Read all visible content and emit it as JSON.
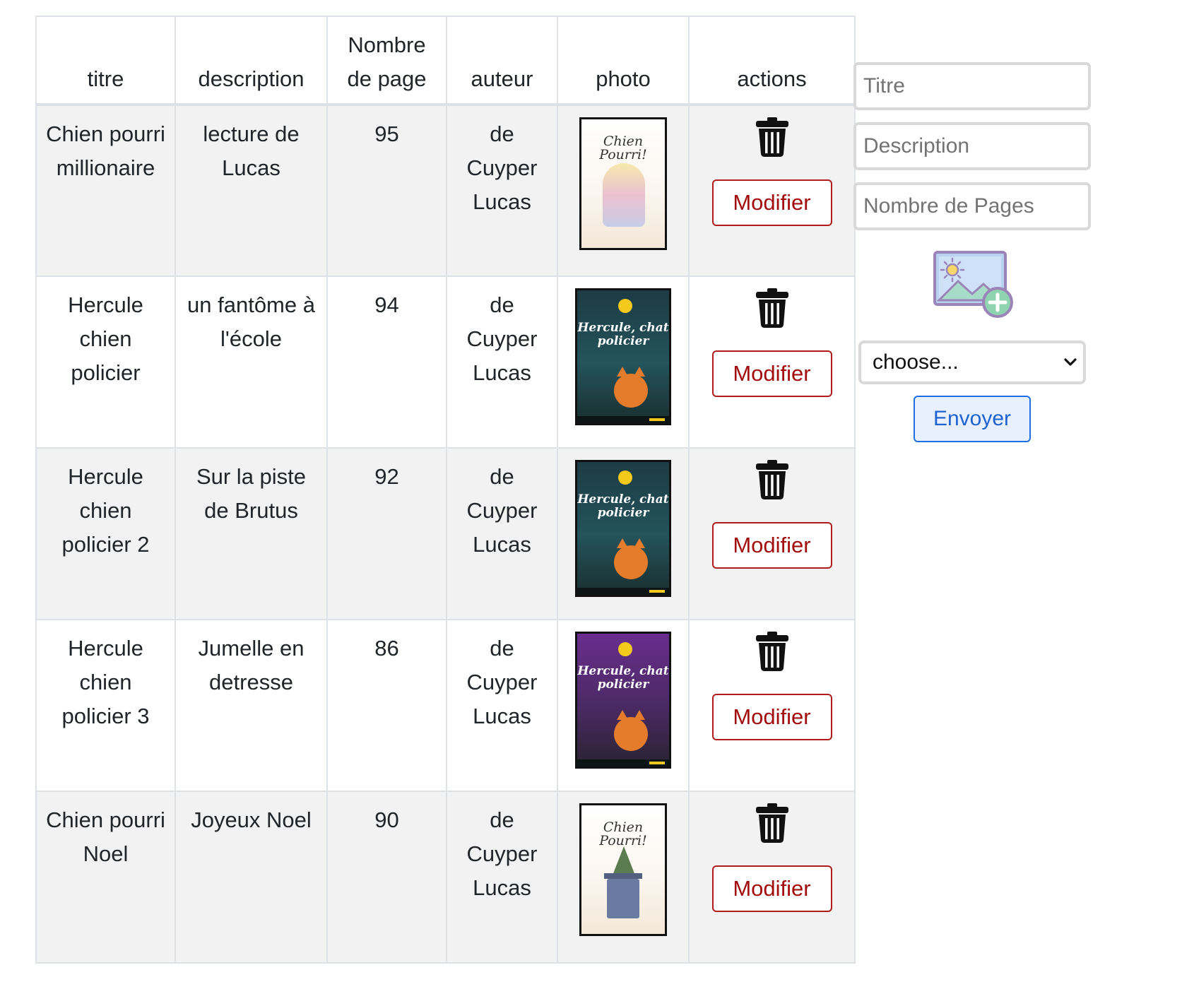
{
  "table": {
    "headers": {
      "titre": "titre",
      "description": "description",
      "pages_line1": "Nombre",
      "pages_line2": "de page",
      "auteur": "auteur",
      "photo": "photo",
      "actions": "actions"
    },
    "rows": [
      {
        "titre": "Chien pourri millionaire",
        "description": "lecture de Lucas",
        "pages": "95",
        "auteur": "de Cuyper Lucas",
        "cover_title": "Chien Pourri!",
        "modifier_label": "Modifier"
      },
      {
        "titre": "Hercule chien policier",
        "description": "un fantôme à l'école",
        "pages": "94",
        "auteur": "de Cuyper Lucas",
        "cover_title": "Hercule, chat policier",
        "modifier_label": "Modifier"
      },
      {
        "titre": "Hercule chien policier 2",
        "description": "Sur la piste de Brutus",
        "pages": "92",
        "auteur": "de Cuyper Lucas",
        "cover_title": "Hercule, chat policier",
        "modifier_label": "Modifier"
      },
      {
        "titre": "Hercule chien policier 3",
        "description": "Jumelle en detresse",
        "pages": "86",
        "auteur": "de Cuyper Lucas",
        "cover_title": "Hercule, chat policier",
        "modifier_label": "Modifier"
      },
      {
        "titre": "Chien pourri Noel",
        "description": "Joyeux Noel",
        "pages": "90",
        "auteur": "de Cuyper Lucas",
        "cover_title": "Chien Pourri!",
        "modifier_label": "Modifier"
      }
    ]
  },
  "form": {
    "titre_placeholder": "Titre",
    "description_placeholder": "Description",
    "pages_placeholder": "Nombre de Pages",
    "image_icon": "image-add-icon",
    "select_value": "choose...",
    "submit_label": "Envoyer"
  },
  "colors": {
    "modifier_border": "#b01c1c",
    "modifier_text": "#a30c0c",
    "envoyer_border": "#1f6fe0",
    "envoyer_bg": "#e8effd",
    "row_striped": "#f2f2f2"
  },
  "icons": {
    "delete": "trash-icon",
    "select_arrow": "chevron-down-icon"
  }
}
